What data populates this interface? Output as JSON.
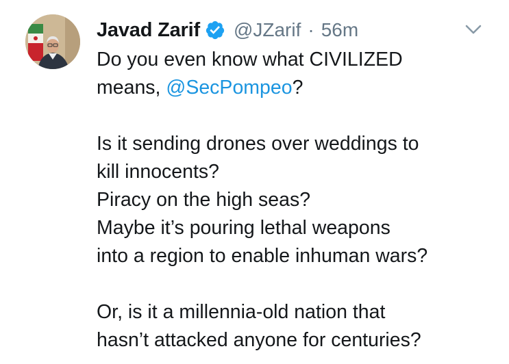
{
  "tweet": {
    "author_name": "Javad Zarif",
    "handle": "@JZarif",
    "separator": "·",
    "timestamp": "56m",
    "verified": true,
    "colors": {
      "text": "#14171a",
      "secondary": "#657786",
      "link": "#1b95e0",
      "verified_badge": "#1da1f2"
    },
    "icons": {
      "verified": "verified-badge-icon",
      "menu": "chevron-down-icon"
    },
    "text": {
      "p1_line1": "Do you even know what CIVILIZED",
      "p1_line2_prefix": "means, ",
      "p1_mention": "@SecPompeo",
      "p1_line2_suffix": "?",
      "p2_line1": "Is it sending drones over weddings to",
      "p2_line2": "kill innocents?",
      "p2_line3": "Piracy on the high seas?",
      "p2_line4": "Maybe it’s pouring lethal weapons",
      "p2_line5": "into a region to enable inhuman wars?",
      "p3_line1": "Or, is it a millennia-old nation that",
      "p3_line2": "hasn’t attacked anyone for centuries?"
    }
  }
}
